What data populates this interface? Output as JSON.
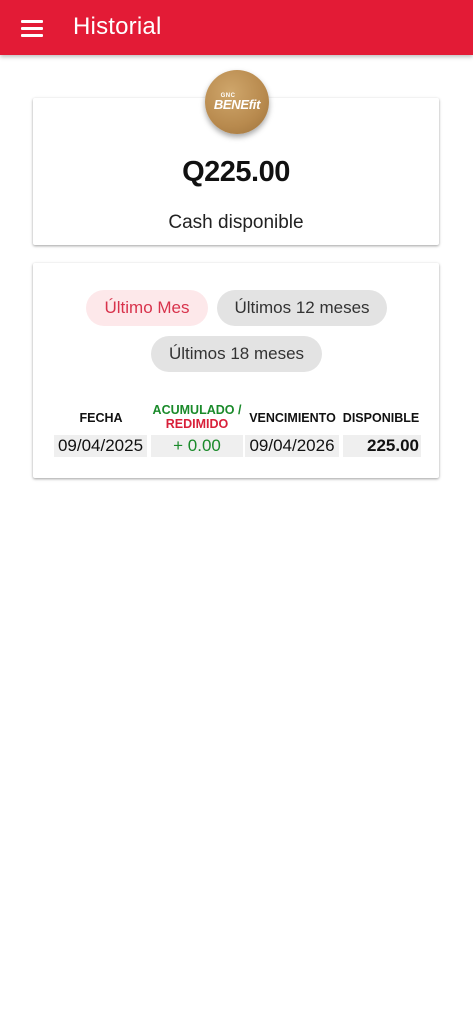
{
  "appbar": {
    "title": "Historial"
  },
  "balance": {
    "logo_small": "GNC",
    "logo_main": "BENEfit",
    "amount": "Q225.00",
    "label": "Cash disponible"
  },
  "filters": {
    "items": [
      "Último Mes",
      "Últimos 12 meses",
      "Últimos 18 meses"
    ],
    "selected": "Último Mes"
  },
  "table": {
    "headers": {
      "fecha": "FECHA",
      "acumulado": "ACUMULADO /",
      "redimido": "REDIMIDO",
      "vencimiento": "VENCIMIENTO",
      "disponible": "DISPONIBLE"
    },
    "rows": [
      {
        "fecha": "09/04/2025",
        "acumulado": "+ 0.00",
        "vencimiento": "09/04/2026",
        "disponible": "225.00"
      }
    ]
  },
  "colors": {
    "brand_red": "#e31b36",
    "accumulated_green": "#1a8a2a",
    "redeemed_red": "#d8203a",
    "logo_gold": "#b88a4e"
  }
}
